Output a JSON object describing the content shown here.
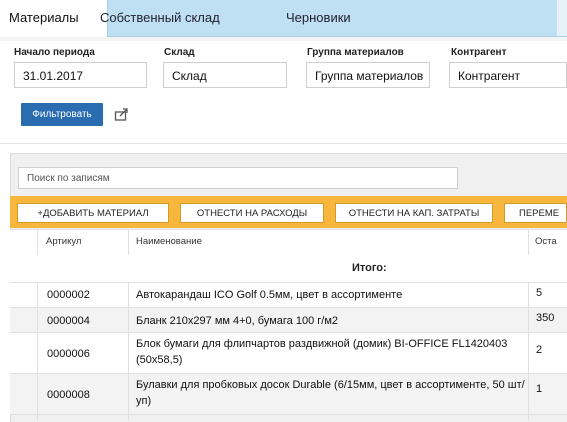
{
  "tabs": [
    {
      "label": "Материалы",
      "active": true
    },
    {
      "label": "Собственный склад",
      "active": false
    },
    {
      "label": "Черновики",
      "active": false
    }
  ],
  "filters": {
    "period_label": "Начало периода",
    "period_value": "31.01.2017",
    "warehouse_label": "Склад",
    "warehouse_value": "Склад",
    "group_label": "Группа материалов",
    "group_value": "Группа материалов",
    "counterparty_label": "Контрагент",
    "counterparty_value": "Контрагент",
    "filter_button": "Фильтровать"
  },
  "search": {
    "placeholder": "Поиск по записям"
  },
  "toolbar": {
    "add": "+ДОБАВИТЬ МАТЕРИАЛ",
    "expense": "ОТНЕСТИ НА РАСХОДЫ",
    "capex": "ОТНЕСТИ НА КАП. ЗАТРАТЫ",
    "move": "ПЕРЕМЕ"
  },
  "table": {
    "columns": {
      "article": "Артикул",
      "name": "Наименование",
      "rest": "Оста"
    },
    "total_label": "Итого:",
    "rows": [
      {
        "article": "0000002",
        "name": "Автокарандаш ICO Golf 0.5мм, цвет в ассортименте",
        "rest": "5"
      },
      {
        "article": "0000004",
        "name": "Бланк 210x297 мм 4+0, бумага 100 г/м2",
        "rest": "350"
      },
      {
        "article": "0000006",
        "name": "Блок бумаги для флипчартов раздвижной (домик) BI-OFFICE FL1420403 (50x58,5)",
        "rest": "2"
      },
      {
        "article": "0000008",
        "name": "Булавки для пробковых досок Durable (6/15мм, цвет в ассортименте, 50 шт/уп)",
        "rest": "1"
      }
    ]
  },
  "colors": {
    "tabs_bg": "#bfe0f3",
    "filter_button": "#2a6cb0",
    "toolbar": "#f6b73c"
  }
}
